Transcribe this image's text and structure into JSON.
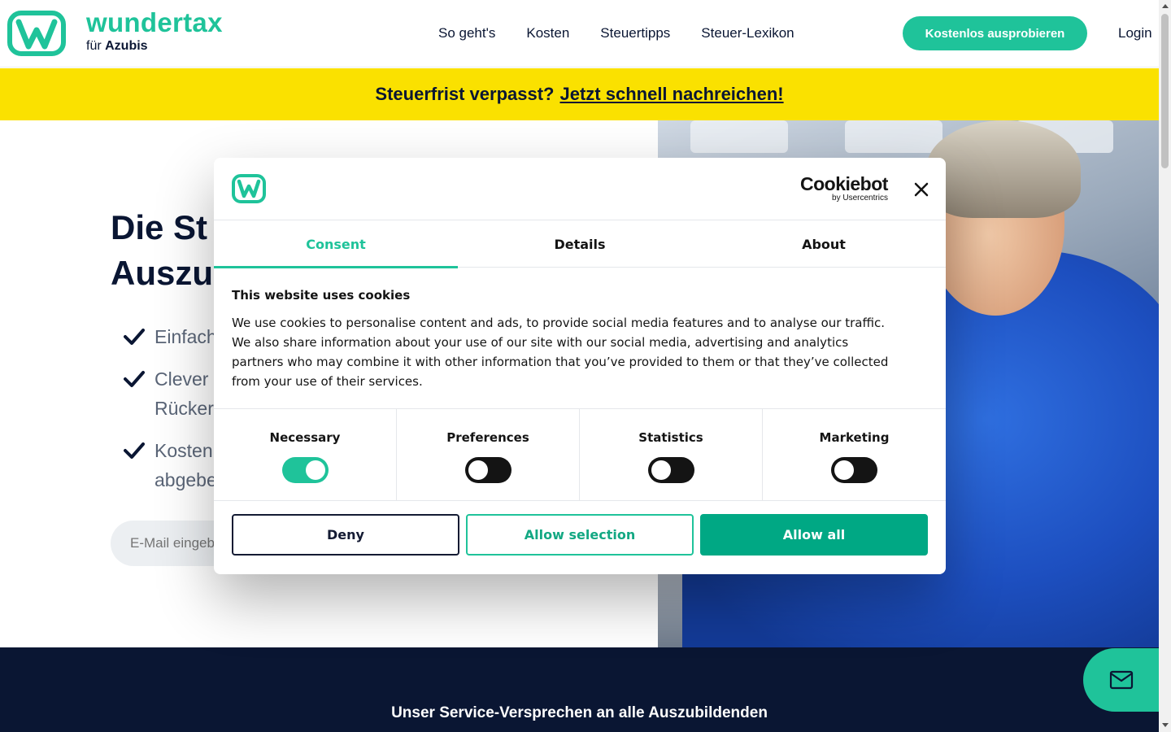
{
  "header": {
    "brand_name": "wundertax",
    "brand_sub_prefix": "für",
    "brand_sub_bold": "Azubis",
    "nav": [
      "So geht's",
      "Kosten",
      "Steuertipps",
      "Steuer-Lexikon"
    ],
    "cta_label": "Kostenlos ausprobieren",
    "login_label": "Login"
  },
  "banner": {
    "text": "Steuerfrist verpasst?",
    "link": "Jetzt schnell nachreichen!"
  },
  "hero": {
    "title_line1": "Die St",
    "title_line2": "Auszub",
    "bullets": [
      "Einfach",
      "Clever",
      "Kosten"
    ],
    "bullet2_line2": "Rücker",
    "bullet3_line2": "abgebe",
    "email_placeholder": "E-Mail eingeb"
  },
  "band": {
    "text": "Unser Service-Versprechen an alle Auszubildenden"
  },
  "dialog": {
    "provider_name": "Cookiebot",
    "provider_sub": "by Usercentrics",
    "tabs": [
      "Consent",
      "Details",
      "About"
    ],
    "active_tab": "Consent",
    "heading": "This website uses cookies",
    "body": "We use cookies to personalise content and ads, to provide social media features and to analyse our traffic. We also share information about your use of our site with our social media, advertising and analytics partners who may combine it with other information that you’ve provided to them or that they’ve collected from your use of their services.",
    "categories": [
      {
        "label": "Necessary",
        "enabled": true
      },
      {
        "label": "Preferences",
        "enabled": false
      },
      {
        "label": "Statistics",
        "enabled": false
      },
      {
        "label": "Marketing",
        "enabled": false
      }
    ],
    "buttons": {
      "deny": "Deny",
      "allow_selection": "Allow selection",
      "allow_all": "Allow all"
    }
  },
  "colors": {
    "brand_green": "#1fc39a",
    "navy": "#0a1633",
    "banner_yellow": "#fae100",
    "allow_all_green": "#00a884"
  }
}
